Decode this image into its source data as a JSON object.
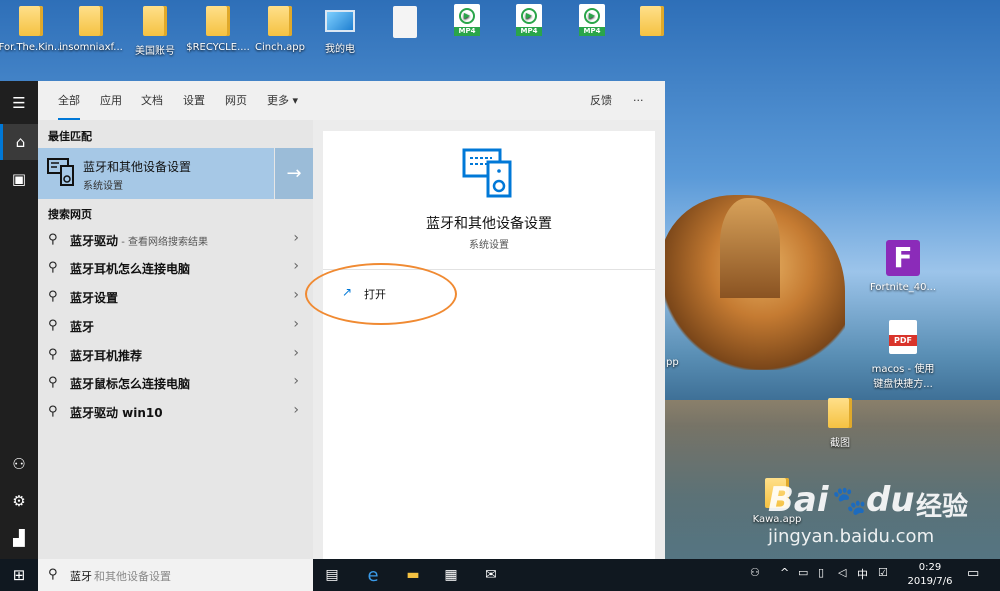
{
  "desktop": {
    "top_icons": [
      {
        "label": "For.The.Kin...",
        "kind": "folder"
      },
      {
        "label": "insomniaxf...",
        "kind": "folder"
      },
      {
        "label": "美国账号",
        "kind": "folder"
      },
      {
        "label": "$RECYCLE....",
        "kind": "folder"
      },
      {
        "label": "Cinch.app",
        "kind": "folder"
      },
      {
        "label": "我的电",
        "kind": "computer"
      },
      {
        "label": "",
        "kind": "blank-file"
      },
      {
        "label": "",
        "kind": "mp4",
        "tag": "MP4"
      },
      {
        "label": "",
        "kind": "mp4",
        "tag": "MP4"
      },
      {
        "label": "",
        "kind": "mp4",
        "tag": "MP4"
      },
      {
        "label": "",
        "kind": "folder"
      }
    ],
    "right_icons": [
      {
        "label": "Fortnite_40...",
        "kind": "fortnite",
        "glyph": "F"
      },
      {
        "label": "macos - 使用\n键盘快捷方...",
        "kind": "pdf",
        "tag": "PDF"
      },
      {
        "label": "截图",
        "kind": "folder"
      },
      {
        "label": "Kawa.app",
        "kind": "folder"
      }
    ],
    "partial_label": "pp"
  },
  "start_menu": {
    "rail": {
      "menu_icon": "hamburger-icon",
      "home_icon": "home-icon",
      "docs_icon": "document-icon",
      "user_icon": "user-icon",
      "settings_icon": "gear-icon",
      "photos_icon": "photos-icon"
    },
    "tabs": [
      "全部",
      "应用",
      "文档",
      "设置",
      "网页",
      "更多"
    ],
    "more_caret": "▾",
    "feedback": "反馈",
    "ellipsis": "···",
    "best_match_header": "最佳匹配",
    "best_match": {
      "title": "蓝牙和其他设备设置",
      "subtitle": "系统设置",
      "arrow": "→"
    },
    "web_header": "搜索网页",
    "web_results": [
      {
        "text": "蓝牙驱动",
        "sub": " - 查看网络搜索结果"
      },
      {
        "text": "蓝牙耳机怎么连接电脑",
        "sub": ""
      },
      {
        "text": "蓝牙设置",
        "sub": ""
      },
      {
        "text": "蓝牙",
        "sub": ""
      },
      {
        "text": "蓝牙耳机推荐",
        "sub": ""
      },
      {
        "text": "蓝牙鼠标怎么连接电脑",
        "sub": ""
      },
      {
        "text": "蓝牙驱动 win10",
        "sub": ""
      }
    ],
    "preview": {
      "title": "蓝牙和其他设备设置",
      "subtitle": "系统设置",
      "open_label": "打开"
    }
  },
  "search_box": {
    "typed": "蓝牙",
    "suggestion": "和其他设备设置"
  },
  "taskbar": {
    "time": "0:29",
    "date": "2019/7/6",
    "ime": "中",
    "tray_caret": "^"
  },
  "watermark": {
    "brand": "Bai",
    "brand2": "du",
    "cn": "经验",
    "url": "jingyan.baidu.com"
  },
  "colors": {
    "accent": "#0078d7",
    "highlight_circle": "#f08a32",
    "selection": "#a6c8e6"
  }
}
